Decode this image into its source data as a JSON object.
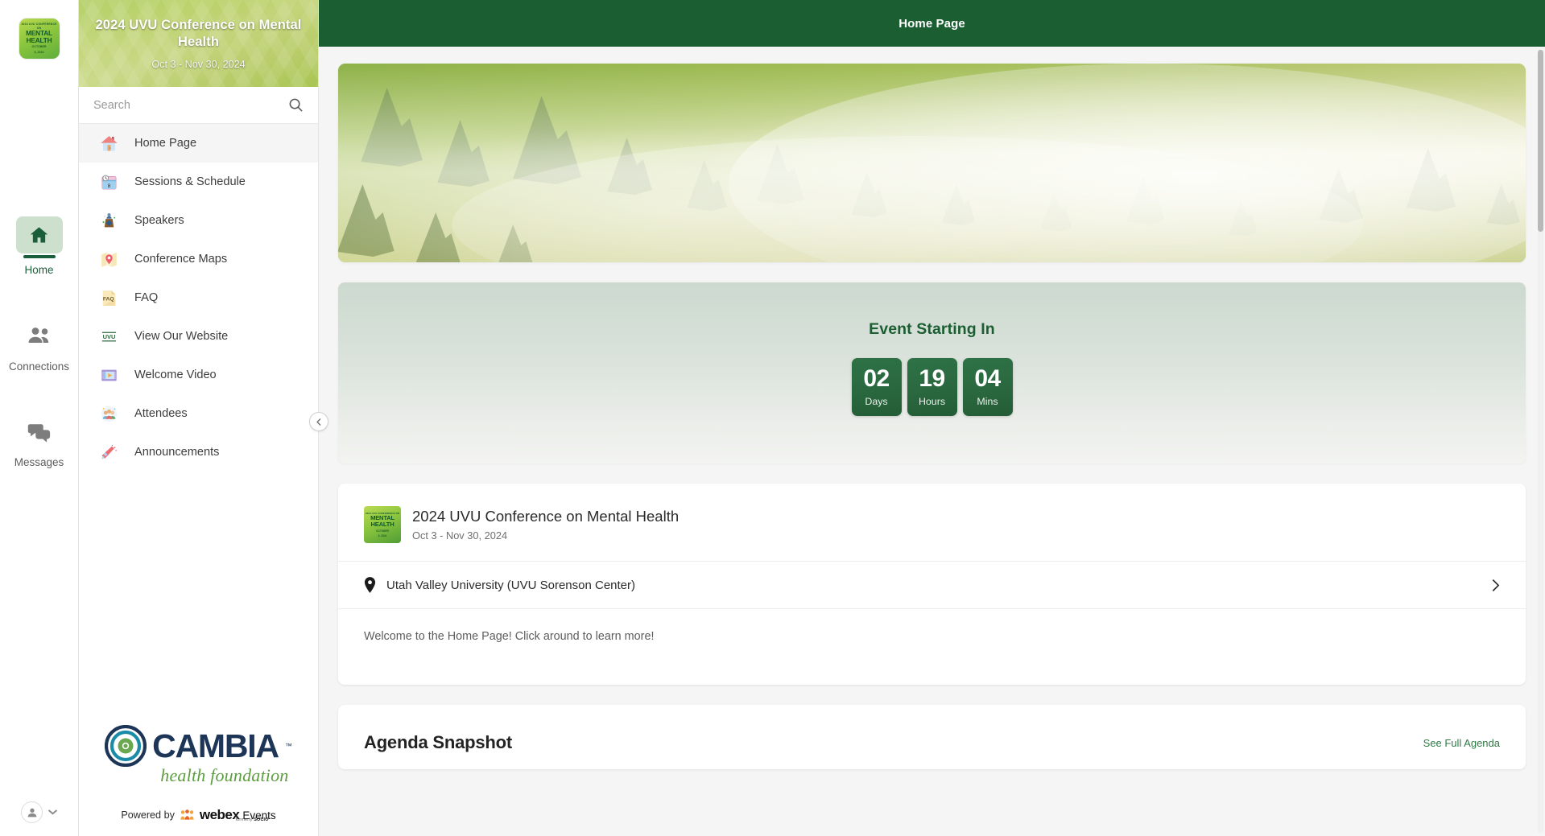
{
  "rail": {
    "logo": {
      "line1": "2024 UVU CONFERENCE ON",
      "line2a": "MENTAL",
      "line2b": "HEALTH",
      "line3a": "OCTOBER",
      "line3b": "3, 2024"
    },
    "items": [
      {
        "label": "Home",
        "icon": "home-icon",
        "active": true
      },
      {
        "label": "Connections",
        "icon": "people-icon",
        "active": false
      },
      {
        "label": "Messages",
        "icon": "chat-bubbles-icon",
        "active": false
      }
    ],
    "avatar_icon": "person-avatar-icon",
    "chevron_icon": "chevron-down-icon"
  },
  "sidebar": {
    "event_title": "2024 UVU Conference on Mental Health",
    "event_dates": "Oct 3 - Nov 30, 2024",
    "search": {
      "placeholder": "Search",
      "value": "",
      "icon": "search-icon"
    },
    "nav": [
      {
        "label": "Home Page",
        "icon": "house-icon",
        "active": true
      },
      {
        "label": "Sessions & Schedule",
        "icon": "calendar-clock-icon",
        "active": false
      },
      {
        "label": "Speakers",
        "icon": "podium-speaker-icon",
        "active": false
      },
      {
        "label": "Conference Maps",
        "icon": "map-pin-icon",
        "active": false
      },
      {
        "label": "FAQ",
        "icon": "faq-document-icon",
        "active": false
      },
      {
        "label": "View Our Website",
        "icon": "uvu-logo-icon",
        "active": false
      },
      {
        "label": "Welcome Video",
        "icon": "film-play-icon",
        "active": false
      },
      {
        "label": "Attendees",
        "icon": "attendees-group-icon",
        "active": false
      },
      {
        "label": "Announcements",
        "icon": "megaphone-icon",
        "active": false
      }
    ],
    "sponsor": {
      "name": "CAMBIA",
      "trademark": "™",
      "tagline": "health foundation"
    },
    "powered_by": {
      "prefix": "Powered by",
      "brand": "webex",
      "product": "Events",
      "formerly_label": "formerly",
      "formerly_brand": "SOCIO",
      "icon": "webex-people-icon"
    },
    "collapse_icon": "chevron-left-icon"
  },
  "topbar": {
    "title": "Home Page"
  },
  "banner": {
    "alt": "misty forest banner"
  },
  "countdown": {
    "title": "Event Starting In",
    "units": [
      {
        "value": "02",
        "label": "Days"
      },
      {
        "value": "19",
        "label": "Hours"
      },
      {
        "value": "04",
        "label": "Mins"
      }
    ]
  },
  "event": {
    "logo": {
      "line1": "2024 UVU CONFERENCE ON",
      "line2a": "MENTAL",
      "line2b": "HEALTH",
      "line3a": "OCTOBER",
      "line3b": "3, 2024"
    },
    "name": "2024 UVU Conference on Mental Health",
    "dates": "Oct 3 - Nov 30, 2024",
    "location": "Utah Valley University (UVU Sorenson Center)",
    "location_icon": "map-pin-icon",
    "location_chevron": "chevron-right-icon",
    "welcome": "Welcome to the Home Page! Click around to learn more!"
  },
  "agenda": {
    "title": "Agenda Snapshot",
    "link": "See Full Agenda"
  },
  "colors": {
    "brand_green": "#1b5e32",
    "accent_green": "#2f7a45",
    "sidebar_gradient_start": "#a5c64a",
    "sidebar_gradient_end": "#a9c552",
    "countdown_box": "#2b6a40",
    "cambia_navy": "#1d3557",
    "cambia_green": "#5c9e3f"
  }
}
